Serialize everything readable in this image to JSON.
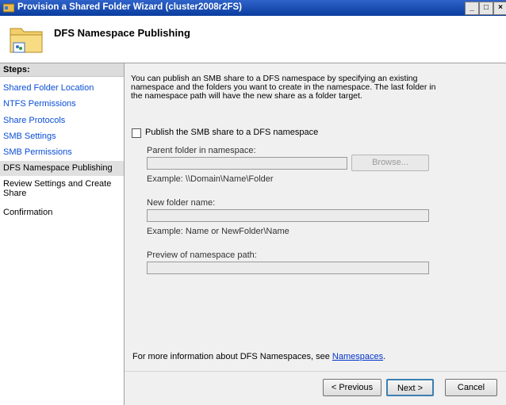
{
  "window": {
    "title": "Provision a Shared Folder Wizard (cluster2008r2FS)",
    "minimize": "_",
    "maximize": "□",
    "close": "×"
  },
  "header": {
    "title": "DFS Namespace Publishing",
    "icon": "shared-folder-icon"
  },
  "sidebar": {
    "heading": "Steps:",
    "items": [
      {
        "label": "Shared Folder Location",
        "state": "link"
      },
      {
        "label": "NTFS Permissions",
        "state": "link"
      },
      {
        "label": "Share Protocols",
        "state": "link"
      },
      {
        "label": "SMB Settings",
        "state": "link"
      },
      {
        "label": "SMB Permissions",
        "state": "link"
      },
      {
        "label": "DFS Namespace Publishing",
        "state": "current"
      },
      {
        "label": "Review Settings and Create Share",
        "state": "plain"
      },
      {
        "label": "Confirmation",
        "state": "plain"
      }
    ]
  },
  "main": {
    "intro": "You can publish an SMB share to a DFS namespace by specifying an existing namespace and the folders you want to create in the namespace. The last folder in the namespace path will have the new share as a folder target.",
    "publish_checkbox": {
      "label": "Publish the SMB share to a DFS namespace",
      "checked": false
    },
    "parent_folder": {
      "label": "Parent folder in namespace:",
      "value": "",
      "example": "Example: \\\\Domain\\Name\\Folder"
    },
    "browse_label": "Browse...",
    "new_folder": {
      "label": "New folder name:",
      "value": "",
      "example": "Example: Name or NewFolder\\Name"
    },
    "preview": {
      "label": "Preview of namespace path:",
      "value": ""
    },
    "more_info_prefix": "For more information about DFS Namespaces, see ",
    "more_info_link": "Namespaces",
    "more_info_suffix": "."
  },
  "footer": {
    "previous": "< Previous",
    "next": "Next >",
    "cancel": "Cancel"
  }
}
